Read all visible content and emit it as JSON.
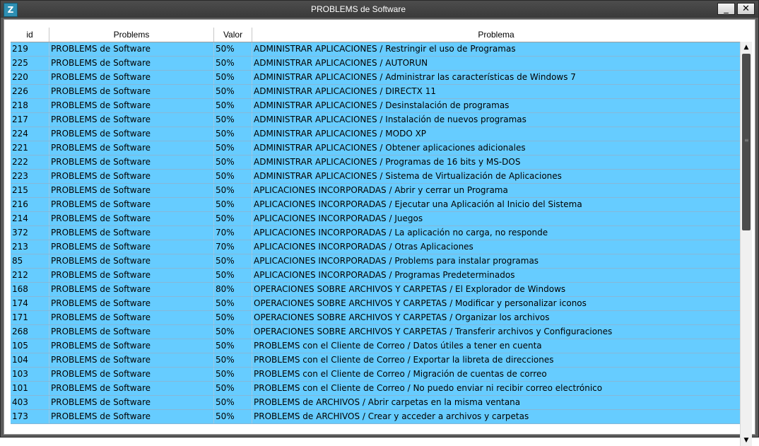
{
  "window": {
    "title": "PROBLEMS de Software",
    "app_icon": "Z",
    "minimize_glyph": "_",
    "close_glyph": "✕"
  },
  "table": {
    "columns": [
      "id",
      "Problems",
      "Valor",
      "Problema"
    ],
    "rows": [
      [
        "219",
        "PROBLEMS de Software",
        "50%",
        "ADMINISTRAR APLICACIONES /  Restringir el uso de Programas"
      ],
      [
        "225",
        "PROBLEMS de Software",
        "50%",
        "ADMINISTRAR APLICACIONES / AUTORUN"
      ],
      [
        "220",
        "PROBLEMS de Software",
        "50%",
        "ADMINISTRAR APLICACIONES / Administrar las características de Windows 7"
      ],
      [
        "226",
        "PROBLEMS de Software",
        "50%",
        "ADMINISTRAR APLICACIONES / DIRECTX 11"
      ],
      [
        "218",
        "PROBLEMS de Software",
        "50%",
        "ADMINISTRAR APLICACIONES / Desinstalación de programas"
      ],
      [
        "217",
        "PROBLEMS de Software",
        "50%",
        "ADMINISTRAR APLICACIONES / Instalación de nuevos programas"
      ],
      [
        "224",
        "PROBLEMS de Software",
        "50%",
        "ADMINISTRAR APLICACIONES / MODO XP"
      ],
      [
        "221",
        "PROBLEMS de Software",
        "50%",
        "ADMINISTRAR APLICACIONES / Obtener aplicaciones adicionales"
      ],
      [
        "222",
        "PROBLEMS de Software",
        "50%",
        "ADMINISTRAR APLICACIONES / Programas de 16 bits y MS-DOS"
      ],
      [
        "223",
        "PROBLEMS de Software",
        "50%",
        "ADMINISTRAR APLICACIONES / Sistema de Virtualización de Aplicaciones"
      ],
      [
        "215",
        "PROBLEMS de Software",
        "50%",
        "APLICACIONES INCORPORADAS / Abrir y cerrar un Programa"
      ],
      [
        "216",
        "PROBLEMS de Software",
        "50%",
        "APLICACIONES INCORPORADAS / Ejecutar una Aplicación al Inicio del Sistema"
      ],
      [
        "214",
        "PROBLEMS de Software",
        "50%",
        "APLICACIONES INCORPORADAS / Juegos"
      ],
      [
        "372",
        "PROBLEMS de Software",
        "70%",
        "APLICACIONES INCORPORADAS / La aplicación no carga, no responde"
      ],
      [
        "213",
        "PROBLEMS de Software",
        "70%",
        "APLICACIONES INCORPORADAS / Otras Aplicaciones"
      ],
      [
        "85",
        "PROBLEMS de Software",
        "50%",
        "APLICACIONES INCORPORADAS / Problems para instalar programas"
      ],
      [
        "212",
        "PROBLEMS de Software",
        "50%",
        "APLICACIONES INCORPORADAS / Programas Predeterminados"
      ],
      [
        "168",
        "PROBLEMS de Software",
        "80%",
        "OPERACIONES SOBRE ARCHIVOS Y CARPETAS / El Explorador de Windows"
      ],
      [
        "174",
        "PROBLEMS de Software",
        "50%",
        "OPERACIONES SOBRE ARCHIVOS Y CARPETAS / Modificar y personalizar iconos"
      ],
      [
        "171",
        "PROBLEMS de Software",
        "50%",
        "OPERACIONES SOBRE ARCHIVOS Y CARPETAS / Organizar los archivos"
      ],
      [
        "268",
        "PROBLEMS de Software",
        "50%",
        "OPERACIONES SOBRE ARCHIVOS Y CARPETAS / Transferir archivos y Configuraciones"
      ],
      [
        "105",
        "PROBLEMS de Software",
        "50%",
        "PROBLEMS con el Cliente de Correo / Datos útiles a tener en cuenta"
      ],
      [
        "104",
        "PROBLEMS de Software",
        "50%",
        "PROBLEMS con el Cliente de Correo / Exportar la libreta de direcciones"
      ],
      [
        "103",
        "PROBLEMS de Software",
        "50%",
        "PROBLEMS con el Cliente de Correo / Migración de cuentas de correo"
      ],
      [
        "101",
        "PROBLEMS de Software",
        "50%",
        "PROBLEMS con el Cliente de Correo / No puedo enviar ni recibir correo electrónico"
      ],
      [
        "403",
        "PROBLEMS de Software",
        "50%",
        "PROBLEMS de ARCHIVOS / Abrir carpetas en la misma ventana"
      ],
      [
        "173",
        "PROBLEMS de Software",
        "50%",
        "PROBLEMS de ARCHIVOS / Crear y acceder a archivos y carpetas"
      ]
    ]
  },
  "scrollbar": {
    "up_glyph": "▲",
    "down_glyph": "▼",
    "grip_glyph": "≡"
  },
  "colors": {
    "row_background": "#66ccff",
    "titlebar": "#3a3a3a"
  }
}
